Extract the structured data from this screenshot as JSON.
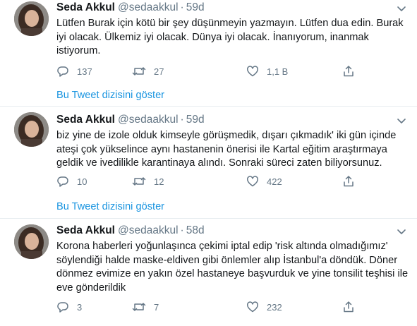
{
  "tweets": [
    {
      "display_name": "Seda Akkul",
      "handle": "@sedaakkul",
      "separator": "·",
      "age": "59d",
      "text": "Lütfen Burak için kötü bir şey düşünmeyin yazmayın. Lütfen dua  edin. Burak\niyi olacak. Ülkemiz iyi olacak. Dünya iyi olacak. İnanıyorum, inanmak\nistiyorum.",
      "replies": "137",
      "retweets": "27",
      "likes": "1,1 B",
      "thread_link": "Bu Tweet dizisini göster"
    },
    {
      "display_name": "Seda Akkul",
      "handle": "@sedaakkul",
      "separator": "·",
      "age": "59d",
      "text": "biz yine de izole olduk kimseyle görüşmedik, dışarı çıkmadık' iki gün içinde\nateşi çok yükselince aynı hastanenin önerisi ile Kartal eğitim araştırmaya\ngeldik ve ivedilikle karantinaya alındı. Sonraki süreci zaten biliyorsunuz.",
      "replies": "10",
      "retweets": "12",
      "likes": "422",
      "thread_link": "Bu Tweet dizisini göster"
    },
    {
      "display_name": "Seda Akkul",
      "handle": "@sedaakkul",
      "separator": "·",
      "age": "58d",
      "text": "Korona haberleri yoğunlaşınca çekimi iptal edip 'risk altında olmadığımız'\nsöylendiği halde maske-eldiven gibi önlemler alıp İstanbul'a döndük. Döner\ndönmez evimize en yakın özel hastaneye başvurduk ve yine tonsilit teşhisi ile\neve gönderildik",
      "replies": "3",
      "retweets": "7",
      "likes": "232"
    }
  ],
  "colors": {
    "link": "#1b95e0",
    "muted": "#657786",
    "text": "#14171a",
    "divider": "#e6ecf0"
  },
  "icons": [
    "reply-icon",
    "retweet-icon",
    "like-icon",
    "share-icon",
    "caret-down-icon"
  ]
}
